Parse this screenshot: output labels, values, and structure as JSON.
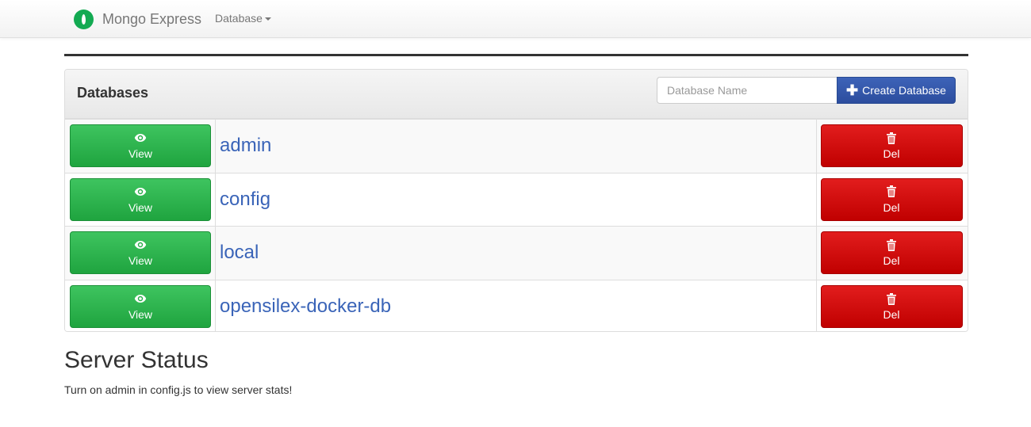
{
  "navbar": {
    "brand": "Mongo Express",
    "menu_database": "Database",
    "logo_icon": "mongodb-leaf-icon",
    "logo_color": "#13aa52"
  },
  "panel": {
    "title": "Databases",
    "input_placeholder": "Database Name",
    "create_label": "Create Database",
    "create_icon": "plus-icon"
  },
  "databases": [
    {
      "name": "admin",
      "view_label": "View",
      "del_label": "Del"
    },
    {
      "name": "config",
      "view_label": "View",
      "del_label": "Del"
    },
    {
      "name": "local",
      "view_label": "View",
      "del_label": "Del"
    },
    {
      "name": "opensilex-docker-db",
      "view_label": "View",
      "del_label": "Del"
    }
  ],
  "icons": {
    "view": "eye-icon",
    "delete": "trash-icon"
  },
  "colors": {
    "view_button": "#28b44a",
    "delete_button": "#d20a0a",
    "create_button": "#3458ab",
    "link": "#3a64b8"
  },
  "server_status": {
    "title": "Server Status",
    "message": "Turn on admin in config.js to view server stats!"
  }
}
